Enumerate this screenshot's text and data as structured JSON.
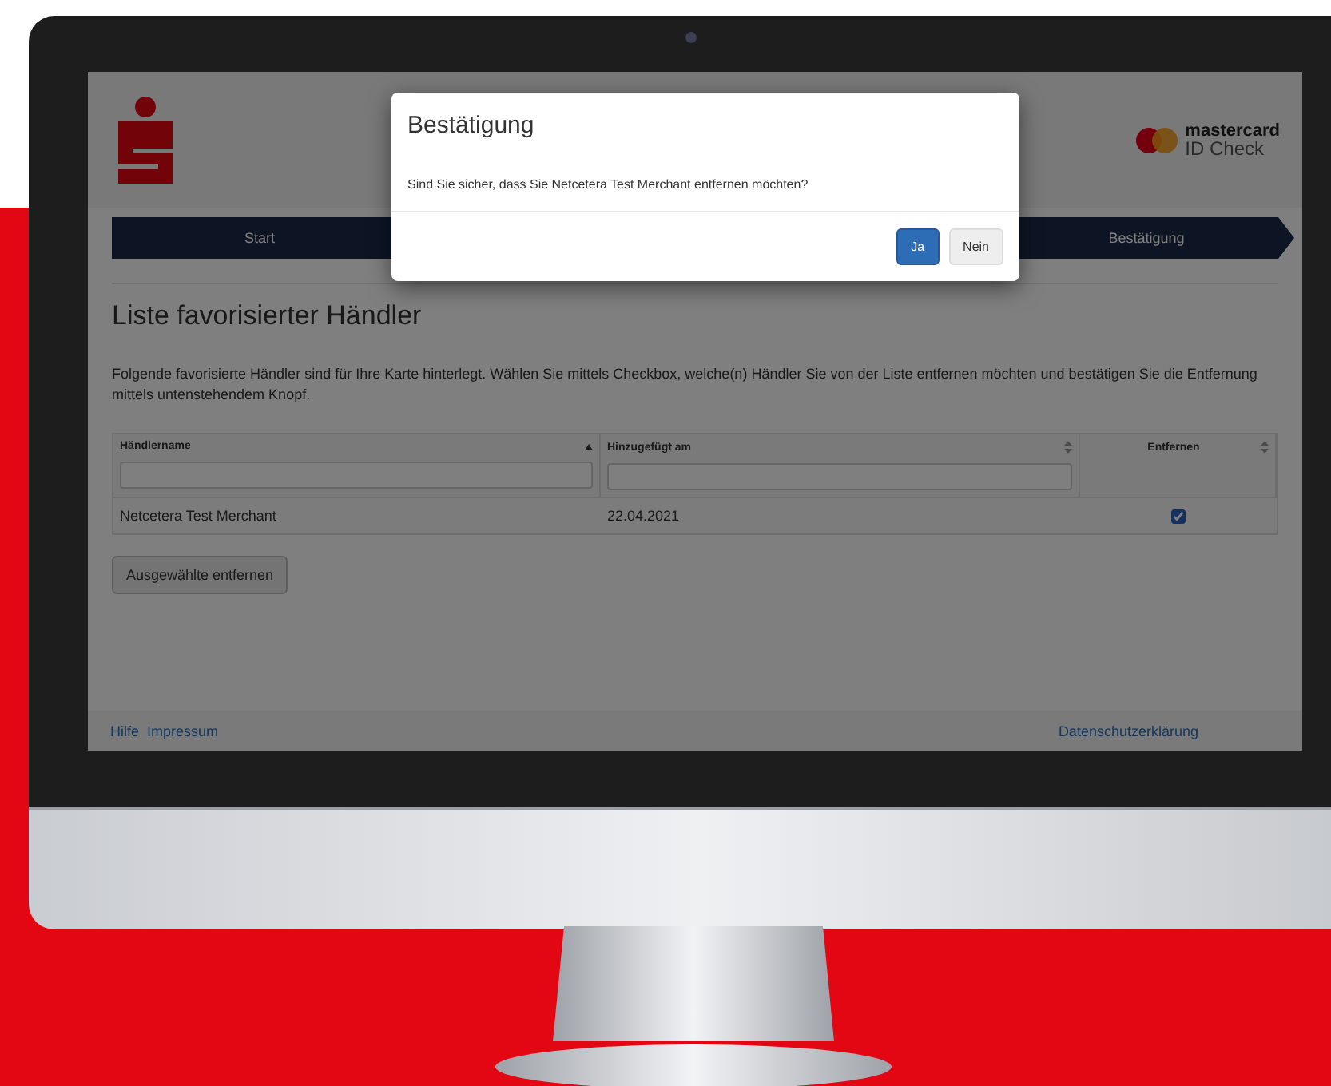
{
  "brand": {
    "name": "mastercard",
    "product": "ID Check"
  },
  "steps": [
    {
      "label": "Start",
      "selected": false
    },
    {
      "label": "Bestätigung",
      "selected": false
    }
  ],
  "page": {
    "title": "Liste favorisierter Händler",
    "intro": "Folgende favorisierte Händler sind für Ihre Karte hinterlegt. Wählen Sie mittels Checkbox, welche(n) Händler Sie von der Liste entfernen möchten und bestätigen Sie die Entfernung mittels untenstehendem Knopf."
  },
  "table": {
    "columns": [
      {
        "label": "Händlername",
        "kind": "text",
        "sorted": true
      },
      {
        "label": "Hinzugefügt am",
        "kind": "text",
        "sorted": false
      },
      {
        "label": "Entfernen",
        "kind": "checkbox",
        "sorted": false
      }
    ],
    "rows": [
      {
        "merchant": "Netcetera Test Merchant",
        "added": "22.04.2021",
        "remove": true
      }
    ]
  },
  "remove_button": "Ausgewählte entfernen",
  "footer": {
    "left_links": [
      "Hilfe",
      "Impressum"
    ],
    "right_links": [
      "Datenschutzerklärung"
    ]
  },
  "dialog": {
    "title": "Bestätigung",
    "message": "Sind Sie sicher, dass Sie Netcetera Test Merchant entfernen möchten?",
    "buttons": [
      {
        "label": "Ja",
        "primary": true
      },
      {
        "label": "Nein",
        "primary": false
      }
    ]
  }
}
